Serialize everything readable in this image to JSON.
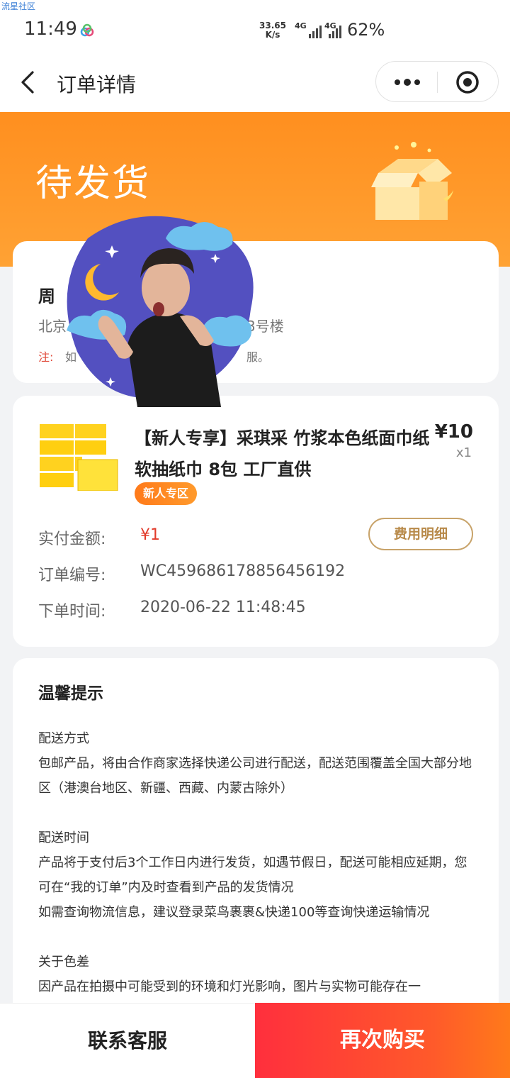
{
  "watermark": "流星社区",
  "status_bar": {
    "time": "11:49",
    "speed_value": "33.65",
    "speed_unit": "K/s",
    "network_1": "4G",
    "network_2": "4G",
    "battery": "62%"
  },
  "nav": {
    "title": "订单详情"
  },
  "order_status": {
    "title": "待发货"
  },
  "address": {
    "name": "周",
    "line_start": "北京",
    "line_end": "3号楼",
    "note_label": "注:",
    "note_text": "如",
    "note_end": "服。"
  },
  "product": {
    "title": "【新人专享】采琪采 竹浆本色纸面巾纸软抽纸巾 8包 工厂直供",
    "price": "¥10",
    "quantity": "x1",
    "tag": "新人专区"
  },
  "order_info": {
    "paid_label": "实付金额:",
    "paid_value": "¥1",
    "fee_button": "费用明细",
    "number_label": "订单编号:",
    "number_value": "WC459686178856456192",
    "time_label": "下单时间:",
    "time_value": "2020-06-22 11:48:45"
  },
  "tips": {
    "title": "温馨提示",
    "shipping_method_title": "配送方式",
    "shipping_method_text": "包邮产品，将由合作商家选择快递公司进行配送，配送范围覆盖全国大部分地区（港澳台地区、新疆、西藏、内蒙古除外）",
    "shipping_time_title": "配送时间",
    "shipping_time_text": "产品将于支付后3个工作日内进行发货，如遇节假日，配送可能相应延期，您可在“我的订单”内及时查看到产品的发货情况",
    "shipping_time_text_2": "如需查询物流信息，建议登录菜鸟裹裹&快递100等查询快递运输情况",
    "color_title": "关于色差",
    "color_text": "因产品在拍摄中可能受到的环境和灯光影响，图片与实物可能存在一"
  },
  "bottom": {
    "service_label": "联系客服",
    "buy_label": "再次购买"
  },
  "colors": {
    "banner": "#ff8f1f",
    "price_red": "#e23b2b",
    "buy_button": "#ff2f3d",
    "fee_button_border": "#c8a36a"
  }
}
